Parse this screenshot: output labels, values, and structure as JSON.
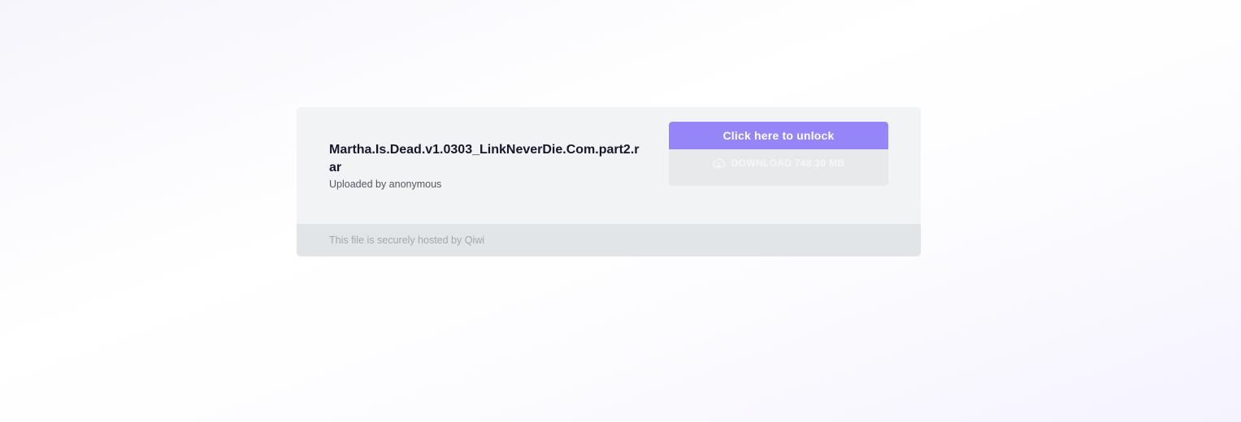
{
  "file": {
    "name": "Martha.Is.Dead.v1.0303_LinkNeverDie.Com.part2.rar",
    "uploader_text": "Uploaded by anonymous"
  },
  "actions": {
    "unlock_label": "Click here to unlock",
    "download_label": "DOWNLOAD 748.30 MB",
    "download_icon": "cloud-download-icon"
  },
  "footer": {
    "text": "This file is securely hosted by Qiwi"
  },
  "colors": {
    "accent": "#9486f8",
    "card_bg": "#f2f3f4",
    "footer_bg": "#e2e5e8",
    "title": "#16172b"
  }
}
